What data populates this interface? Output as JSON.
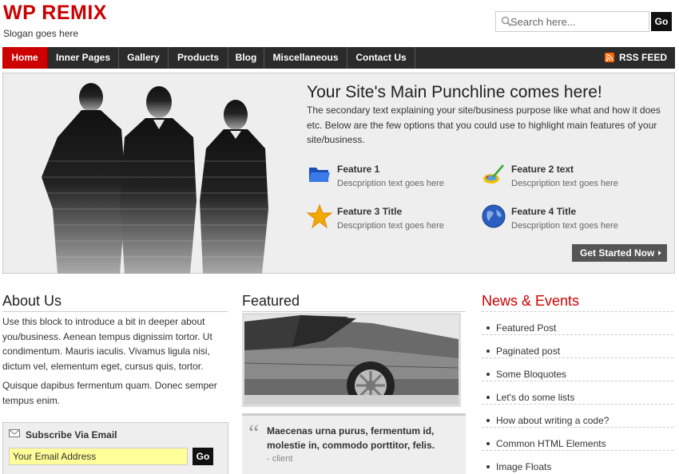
{
  "header": {
    "logo": "WP REMIX",
    "slogan": "Slogan goes here"
  },
  "search": {
    "placeholder": "Search here...",
    "button": "Go"
  },
  "nav": {
    "items": [
      {
        "label": "Home",
        "active": true
      },
      {
        "label": "Inner Pages"
      },
      {
        "label": "Gallery"
      },
      {
        "label": "Products"
      },
      {
        "label": "Blog"
      },
      {
        "label": "Miscellaneous"
      },
      {
        "label": "Contact Us"
      }
    ],
    "rss": "RSS FEED"
  },
  "hero": {
    "title": "Your Site's Main Punchline comes here!",
    "text": "The secondary text explaining your site/business purpose like what and how it does etc. Below are the few options that you could use to highlight main features of your site/business.",
    "features": [
      {
        "title": "Feature 1",
        "desc": "Descpription text goes here",
        "icon": "folder-icon"
      },
      {
        "title": "Feature 2 text",
        "desc": "Descpription text goes here",
        "icon": "paint-icon"
      },
      {
        "title": "Feature 3 Title",
        "desc": "Descpription text goes here",
        "icon": "star-icon"
      },
      {
        "title": "Feature 4 Title",
        "desc": "Descpription text goes here",
        "icon": "globe-icon"
      }
    ],
    "cta": "Get Started Now"
  },
  "about": {
    "heading": "About Us",
    "p1": "Use this block to introduce a bit in deeper about you/business. Aenean tempus dignissim tortor. Ut condimentum. Mauris iaculis. Vivamus ligula nisi, dictum vel, elementum eget, cursus quis, tortor.",
    "p2": "Quisque dapibus fermentum quam. Donec semper tempus enim."
  },
  "subscribe": {
    "title": "Subscribe Via Email",
    "placeholder": "Your Email Address",
    "button": "Go"
  },
  "featured": {
    "heading": "Featured",
    "quote": "Maecenas urna purus, fermentum id, molestie in, commodo porttitor, felis.",
    "author": "- client"
  },
  "news": {
    "heading": "News & Events",
    "items": [
      "Featured Post",
      "Paginated post",
      "Some Bloquotes",
      "Let's do some lists",
      "How about writing a code?",
      "Common HTML Elements",
      "Image Floats"
    ]
  },
  "colors": {
    "brand": "#cc0000",
    "nav_bg": "#2b2b2b",
    "hero_bg": "#eeeeee",
    "input_highlight": "#ffff99"
  }
}
